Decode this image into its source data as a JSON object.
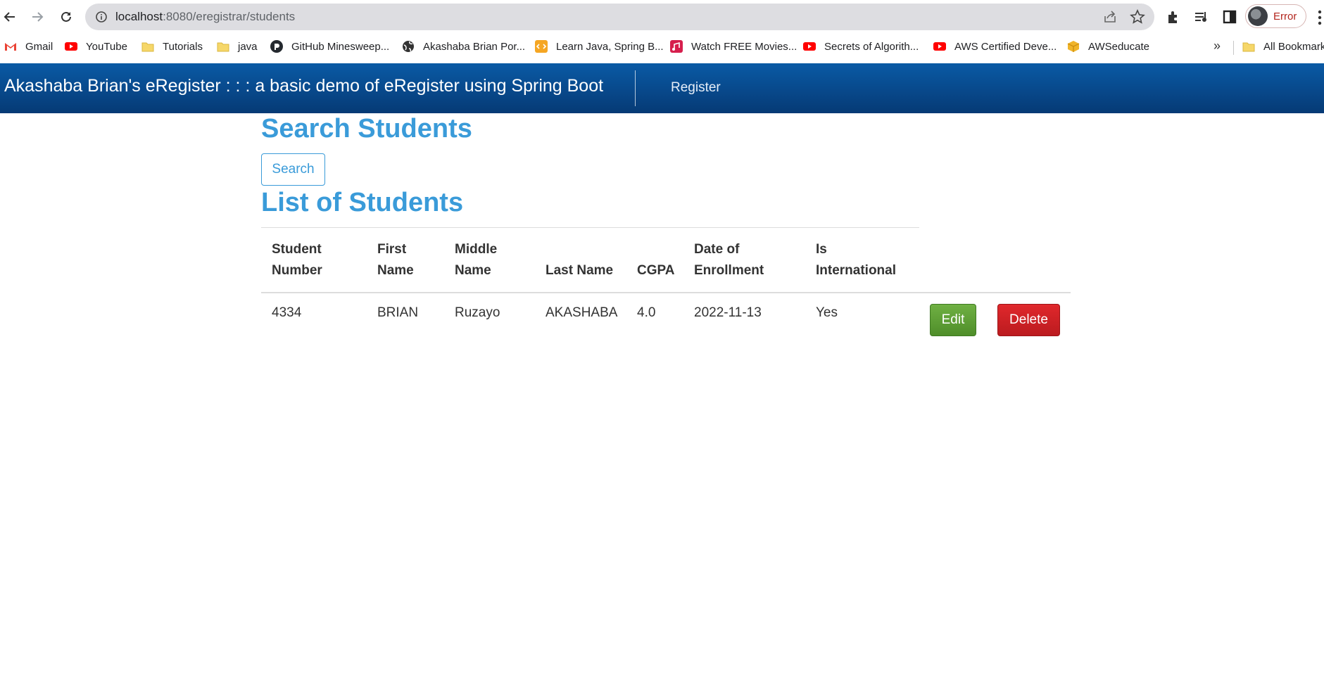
{
  "browser": {
    "url_host": "localhost",
    "url_path": ":8080/eregistrar/students",
    "profile_label": "Error",
    "bookmarks": [
      {
        "label": "Gmail",
        "icon": "gmail-icon",
        "color": "#ea4335"
      },
      {
        "label": "YouTube",
        "icon": "youtube-icon",
        "color": "#ff0000"
      },
      {
        "label": "Tutorials",
        "icon": "folder-icon",
        "color": "#f6d769"
      },
      {
        "label": "java",
        "icon": "folder-icon",
        "color": "#f6d769"
      },
      {
        "label": "GitHub Minesweep...",
        "icon": "github-icon",
        "color": "#24292f"
      },
      {
        "label": "Akashaba Brian Por...",
        "icon": "globe-icon",
        "color": "#333333"
      },
      {
        "label": "Learn Java, Spring B...",
        "icon": "code-icon",
        "color": "#f5a623"
      },
      {
        "label": "Watch FREE Movies...",
        "icon": "movie-icon",
        "color": "#d61f4d"
      },
      {
        "label": "Secrets of Algorith...",
        "icon": "youtube-icon",
        "color": "#ff0000"
      },
      {
        "label": "AWS Certified Deve...",
        "icon": "youtube-icon",
        "color": "#ff0000"
      },
      {
        "label": "AWSeducate",
        "icon": "box-icon",
        "color": "#f0b429"
      }
    ],
    "more_label": "»",
    "all_bookmarks_label": "All Bookmarks"
  },
  "navbar": {
    "brand": "Akashaba Brian's eRegister : : : a basic demo of eRegister using Spring Boot",
    "register_link": "Register",
    "bg_top": "#0a5aa5",
    "bg_bottom": "#063a75"
  },
  "search": {
    "heading": "Search Students",
    "button_label": "Search"
  },
  "list": {
    "heading": "List of Students",
    "columns": [
      {
        "line1": "Student",
        "line2": "Number"
      },
      {
        "line1": "First",
        "line2": "Name"
      },
      {
        "line1": "Middle",
        "line2": "Name"
      },
      {
        "line1": "",
        "line2": "Last Name"
      },
      {
        "line1": "",
        "line2": "CGPA"
      },
      {
        "line1": "Date of",
        "line2": "Enrollment"
      },
      {
        "line1": "Is",
        "line2": "International"
      }
    ],
    "rows": [
      {
        "student_number": "4334",
        "first_name": "BRIAN",
        "middle_name": "Ruzayo",
        "last_name": "AKASHABA",
        "cgpa": "4.0",
        "date_of_enrollment": "2022-11-13",
        "is_international": "Yes",
        "edit_label": "Edit",
        "delete_label": "Delete"
      }
    ]
  },
  "colors": {
    "heading": "#3a9bd9",
    "edit": "#5b9e33",
    "delete": "#cc1f23"
  }
}
